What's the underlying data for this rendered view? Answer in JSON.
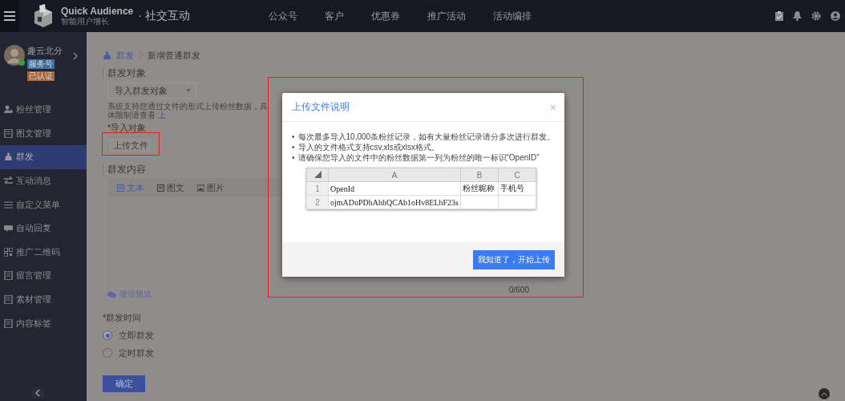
{
  "header": {
    "brand": "Quick Audience",
    "tagline": "智能用户增长",
    "product": "· 社交互动",
    "nav": [
      {
        "label": "公众号",
        "selected": false
      },
      {
        "label": "客户",
        "selected": false
      },
      {
        "label": "优惠券",
        "selected": false
      },
      {
        "label": "推广活动",
        "selected": false
      },
      {
        "label": "活动编排",
        "selected": false
      }
    ]
  },
  "account": {
    "name": "趣云北分",
    "badges": [
      {
        "label": "服务号",
        "color": "#3f6f9a"
      },
      {
        "label": "已认证",
        "color": "#a8683e"
      }
    ]
  },
  "sidebar": {
    "items": [
      {
        "label": "粉丝管理",
        "selected": false
      },
      {
        "label": "图文管理",
        "selected": false
      },
      {
        "label": "群发",
        "selected": true
      },
      {
        "label": "互动消息",
        "selected": false
      },
      {
        "label": "自定义菜单",
        "selected": false
      },
      {
        "label": "自动回复",
        "selected": false
      },
      {
        "label": "推广二维码",
        "selected": false
      },
      {
        "label": "留言管理",
        "selected": false
      },
      {
        "label": "素材管理",
        "selected": false
      },
      {
        "label": "内容标签",
        "selected": false
      }
    ]
  },
  "breadcrumb": [
    "群发",
    "新增普通群发"
  ],
  "form": {
    "target_title": "群发对象",
    "target_select": "导入群发对象",
    "hint": "系统支持您通过文件的形式上传粉丝数据，具体限制请查看",
    "hint_link": "上",
    "import_label": "*导入对象",
    "upload_button": "上传文件",
    "content_title": "群发内容",
    "content_tabs": [
      {
        "label": "文本",
        "selected": true
      },
      {
        "label": "图文",
        "selected": false
      },
      {
        "label": "图片",
        "selected": false
      }
    ],
    "counter": "0/600",
    "preview_link": "微信预览",
    "time_label": "*群发时间",
    "time_options": [
      {
        "label": "立即群发",
        "selected": true
      },
      {
        "label": "定时群发",
        "selected": false
      }
    ],
    "submit": "确定"
  },
  "dialog": {
    "title": "上传文件说明",
    "close": "×",
    "marker": "•",
    "notes": [
      "每次最多导入10,000条粉丝记录，如有大量粉丝记录请分多次进行群发。",
      "导入的文件格式支持csv,xls或xlsx格式。",
      "请确保您导入的文件中的粉丝数据第一列为粉丝的唯一标识“OpenID”"
    ],
    "sheet": {
      "columns": [
        "A",
        "B",
        "C"
      ],
      "rows": [
        {
          "number": "1",
          "cells": [
            "OpenId",
            "粉丝昵称",
            "手机号"
          ]
        },
        {
          "number": "2",
          "cells": [
            "ojmADuPDhAhhQCAb1oHv8ELhF23s"
          ]
        }
      ]
    },
    "confirm": "我知道了，开始上传"
  }
}
